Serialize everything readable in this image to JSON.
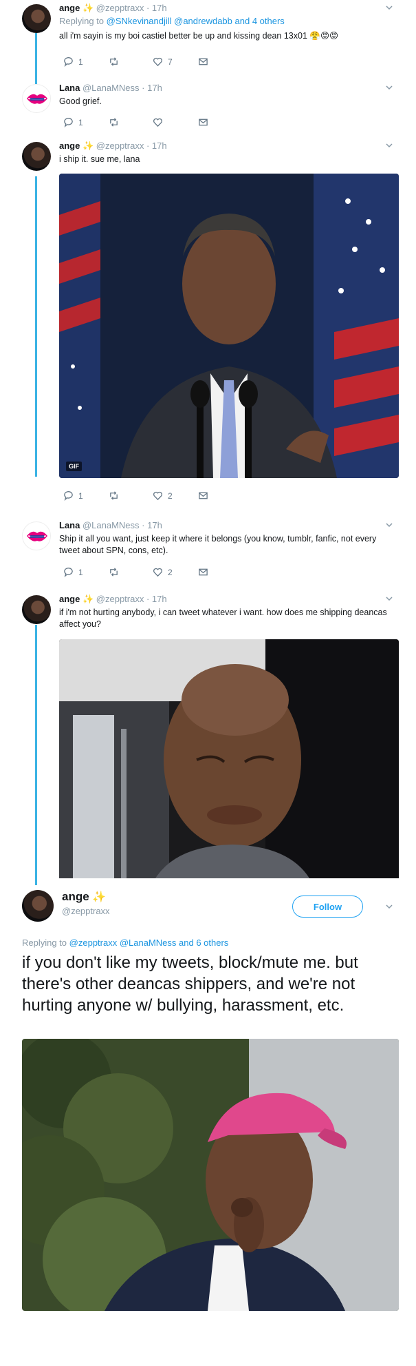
{
  "tweets": [
    {
      "name": "ange",
      "handle": "@zepptraxx",
      "time": "17h",
      "reply_prefix": "Replying to",
      "reply_mentions": "@SNkevinandjill @andrewdabb",
      "reply_suffix": "and 4 others",
      "text": "all i'm sayin is my boi castiel better be up and kissing dean 13x01",
      "emojis": "😤😡😡",
      "replies": "1",
      "retweets": "",
      "likes": "7"
    },
    {
      "name": "Lana",
      "handle": "@LanaMNess",
      "time": "17h",
      "text": "Good grief.",
      "replies": "1",
      "retweets": "",
      "likes": ""
    },
    {
      "name": "ange",
      "handle": "@zepptraxx",
      "time": "17h",
      "text": "i ship it. sue me, lana",
      "gif_badge": "GIF",
      "replies": "1",
      "retweets": "",
      "likes": "2"
    },
    {
      "name": "Lana",
      "handle": "@LanaMNess",
      "time": "17h",
      "text": "Ship it all you want, just keep it where it belongs (you know, tumblr, fanfic, not every tweet about SPN, cons, etc).",
      "replies": "1",
      "retweets": "",
      "likes": "2"
    },
    {
      "name": "ange",
      "handle": "@zepptraxx",
      "time": "17h",
      "text": "if i'm not hurting anybody, i can tweet whatever i want. how does me shipping deancas affect you?"
    }
  ],
  "main_tweet": {
    "name": "ange",
    "handle": "@zepptraxx",
    "follow_label": "Follow",
    "reply_prefix": "Replying to",
    "reply_mentions": "@zepptraxx @LanaMNess",
    "reply_suffix": "and 6 others",
    "text": "if you don't like my tweets, block/mute me. but there's other deancas shippers, and we're not hurting anyone w/ bullying, harassment, etc."
  },
  "icons": [
    "reply-icon",
    "retweet-icon",
    "like-icon",
    "dm-icon",
    "chevron-down-icon",
    "sparkle-icon"
  ],
  "colors": {
    "thread_line": "#3bb3e4",
    "link": "#1b95e0",
    "follow": "#1da1f2",
    "meta": "#8899a6"
  }
}
